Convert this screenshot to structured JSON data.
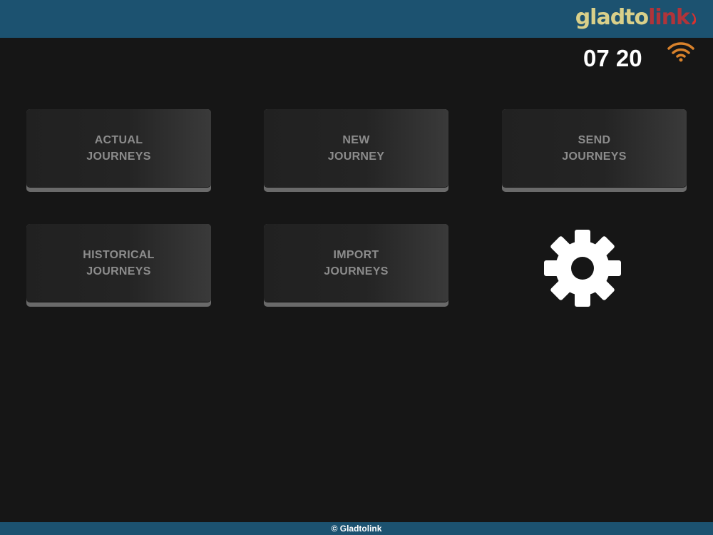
{
  "header": {
    "logo_primary": "gladto",
    "logo_secondary": "link",
    "brand_colors": {
      "bar": "#1c5270",
      "logo_primary": "#d9d08a",
      "logo_secondary": "#b0343a"
    }
  },
  "status": {
    "time": "07 20",
    "wifi_icon": "wifi-icon",
    "wifi_color": "#d9822b"
  },
  "menu": {
    "actual": {
      "line1": "ACTUAL",
      "line2": "JOURNEYS"
    },
    "new": {
      "line1": "NEW",
      "line2": "JOURNEY"
    },
    "send": {
      "line1": "SEND",
      "line2": "JOURNEYS"
    },
    "historical": {
      "line1": "HISTORICAL",
      "line2": "JOURNEYS"
    },
    "import": {
      "line1": "IMPORT",
      "line2": "JOURNEYS"
    },
    "settings_icon": "gear-icon"
  },
  "footer": {
    "copyright": "©  Gladtolink"
  }
}
